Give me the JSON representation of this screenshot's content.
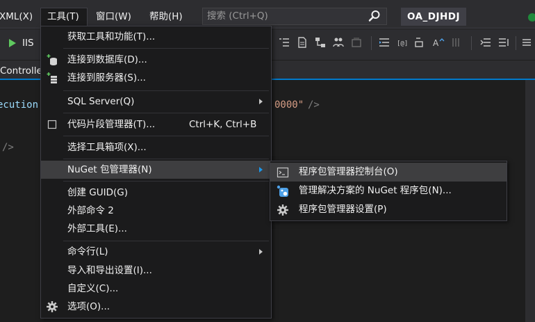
{
  "menubar": {
    "xml": "XML(X)",
    "tools": "工具(T)",
    "window": "窗口(W)",
    "help": "帮助(H)",
    "search_placeholder": "搜索 (Ctrl+Q)",
    "solution_name": "OA_DJHDJ"
  },
  "toolbar": {
    "run_label": "IIS"
  },
  "tabs": {
    "active_tab": "Controlle"
  },
  "editor": {
    "line1": "ecution",
    "line2": "0000\"",
    "line2_tail": "/>",
    "line3": "/>"
  },
  "tools_menu": {
    "items": [
      {
        "label": "获取工具和功能(T)..."
      },
      {
        "label": "连接到数据库(D)..."
      },
      {
        "label": "连接到服务器(S)..."
      },
      {
        "label": "SQL Server(Q)"
      },
      {
        "label": "代码片段管理器(T)...",
        "shortcut": "Ctrl+K, Ctrl+B"
      },
      {
        "label": "选择工具箱项(X)..."
      },
      {
        "label": "NuGet 包管理器(N)"
      },
      {
        "label": "创建 GUID(G)"
      },
      {
        "label": "外部命令 2"
      },
      {
        "label": "外部工具(E)..."
      },
      {
        "label": "命令行(L)"
      },
      {
        "label": "导入和导出设置(I)..."
      },
      {
        "label": "自定义(C)..."
      },
      {
        "label": "选项(O)..."
      }
    ]
  },
  "nuget_submenu": {
    "items": [
      {
        "label": "程序包管理器控制台(O)"
      },
      {
        "label": "管理解决方案的 NuGet 程序包(N)..."
      },
      {
        "label": "程序包管理器设置(P)"
      }
    ]
  },
  "colors": {
    "accent": "#007acc",
    "menu_bg": "#1b1b1c",
    "highlight": "#3e3e40"
  }
}
